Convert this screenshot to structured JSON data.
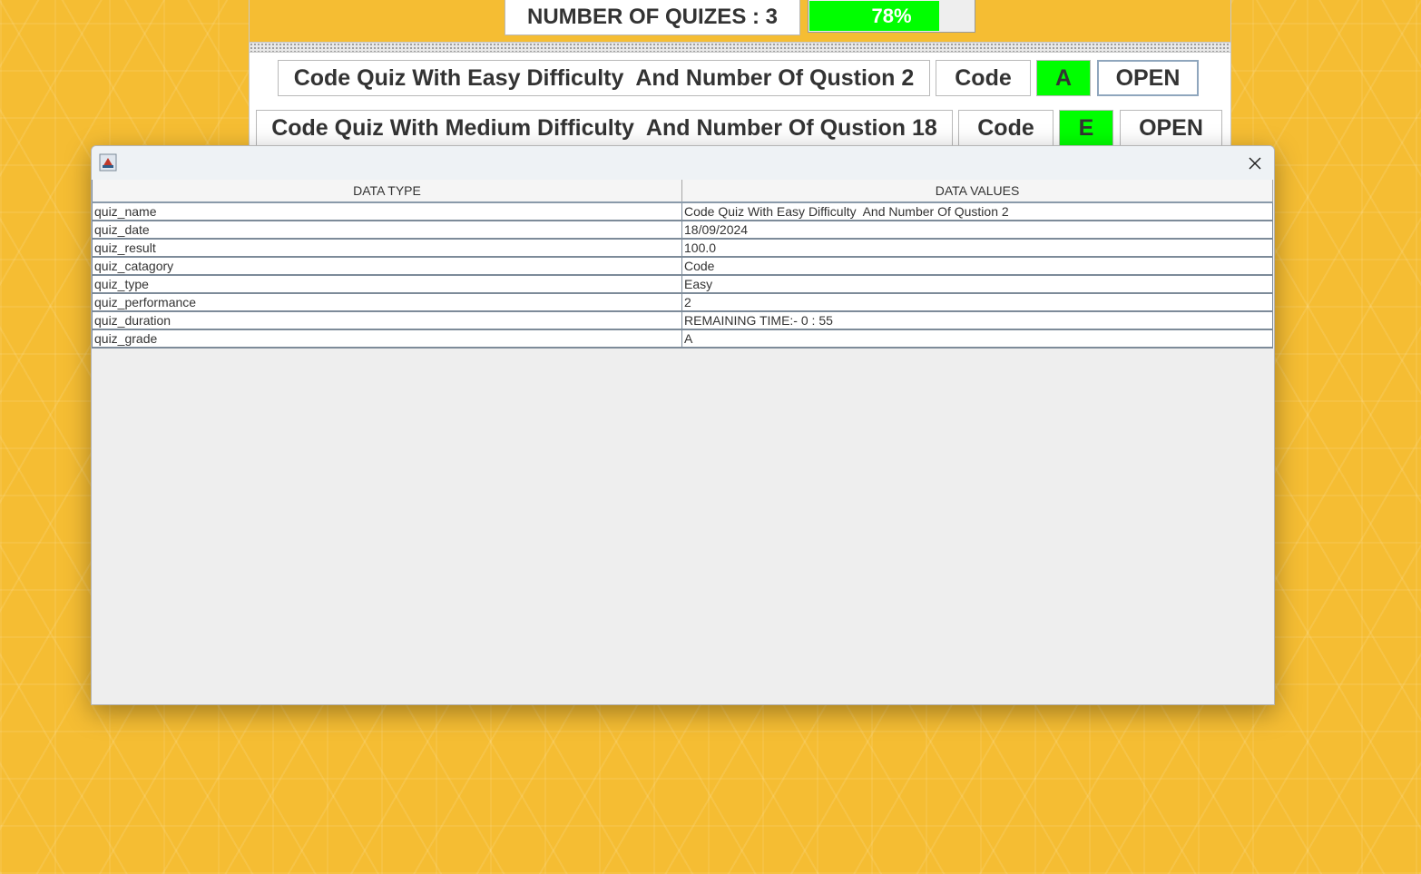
{
  "header": {
    "quiz_count_label": "NUMBER OF QUIZES : 3",
    "progress_text": "78%",
    "progress_fraction": 0.78
  },
  "quiz_rows": [
    {
      "title": "Code Quiz With Easy Difficulty  And Number Of Qustion 2",
      "category": "Code",
      "grade": "A",
      "open_label": "OPEN"
    },
    {
      "title": "Code Quiz With Medium Difficulty  And Number Of Qustion 18",
      "category": "Code",
      "grade": "E",
      "open_label": "OPEN"
    }
  ],
  "dialog": {
    "columns": [
      "DATA TYPE",
      "DATA VALUES"
    ],
    "rows": [
      [
        "quiz_name",
        "Code Quiz With Easy Difficulty  And Number Of Qustion 2"
      ],
      [
        "quiz_date",
        "18/09/2024"
      ],
      [
        "quiz_result",
        "100.0"
      ],
      [
        "quiz_catagory",
        "Code"
      ],
      [
        "quiz_type",
        "Easy"
      ],
      [
        "quiz_performance",
        "2"
      ],
      [
        "quiz_duration",
        "REMAINING TIME:- 0 : 55"
      ],
      [
        "quiz_grade",
        "A"
      ]
    ]
  },
  "colors": {
    "grade_green": "#00ff00",
    "background": "#f5bd33"
  }
}
